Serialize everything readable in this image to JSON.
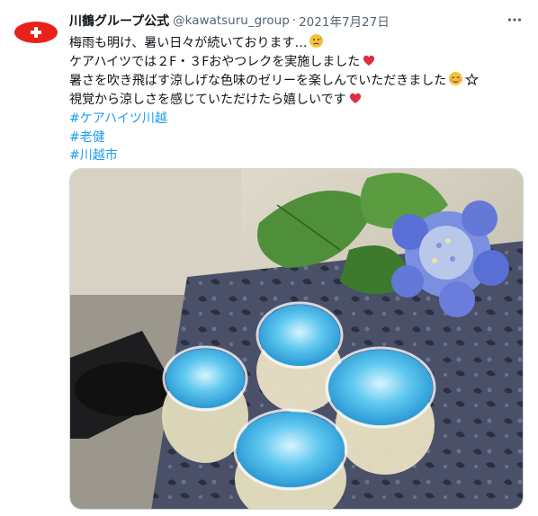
{
  "tweet": {
    "display_name": "川鶴グループ公式",
    "handle": "@kawatsuru_group",
    "separator": "·",
    "date": "2021年7月27日",
    "lines": [
      "梅雨も明け、暑い日々が続いております…",
      "ケアハイツでは２F・３Fおやつレクを実施しました",
      "暑さを吹き飛ばす涼しげな色味のゼリーを楽しんでいただきました",
      "視覚から涼しさを感じていただけたら嬉しいです"
    ],
    "hashtags": [
      "#ケアハイツ川越",
      "#老健",
      "#川越市"
    ]
  },
  "icons": {
    "avatar": "swiss-flag-icon",
    "more": "more-horizontal-icon",
    "line1_emoji": "sweat-face-icon",
    "line2_emoji": "red-heart-icon",
    "line3_emoji": "relieved-face-icon",
    "line3_symbol": "white-star-icon",
    "line4_emoji": "red-heart-icon"
  },
  "colors": {
    "link": "#1d9bf0",
    "muted": "#536471",
    "avatar": "#e8221b"
  }
}
